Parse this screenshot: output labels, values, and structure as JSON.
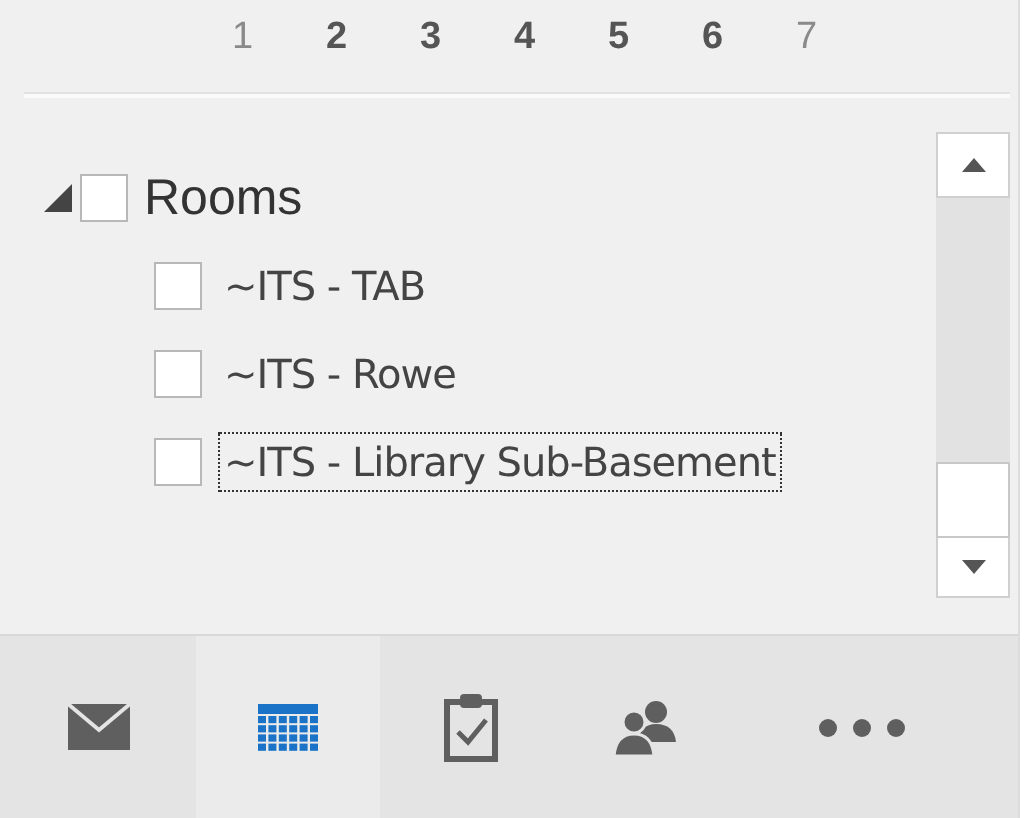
{
  "mini_calendar": {
    "days": [
      {
        "label": "1",
        "muted": true
      },
      {
        "label": "2",
        "muted": false
      },
      {
        "label": "3",
        "muted": false
      },
      {
        "label": "4",
        "muted": false
      },
      {
        "label": "5",
        "muted": false
      },
      {
        "label": "6",
        "muted": false
      },
      {
        "label": "7",
        "muted": true
      }
    ]
  },
  "folder_group": {
    "label": "Rooms",
    "expanded": true,
    "checked": false,
    "children": [
      {
        "label": "~ITS - TAB",
        "checked": false,
        "focused": false
      },
      {
        "label": "~ITS - Rowe",
        "checked": false,
        "focused": false
      },
      {
        "label": "~ITS - Library Sub-Basement",
        "checked": false,
        "focused": true
      }
    ]
  },
  "nav_bar": [
    {
      "kind": "mail",
      "selected": false
    },
    {
      "kind": "calendar",
      "selected": true
    },
    {
      "kind": "tasks",
      "selected": false
    },
    {
      "kind": "people",
      "selected": false
    },
    {
      "kind": "more",
      "selected": false
    }
  ]
}
